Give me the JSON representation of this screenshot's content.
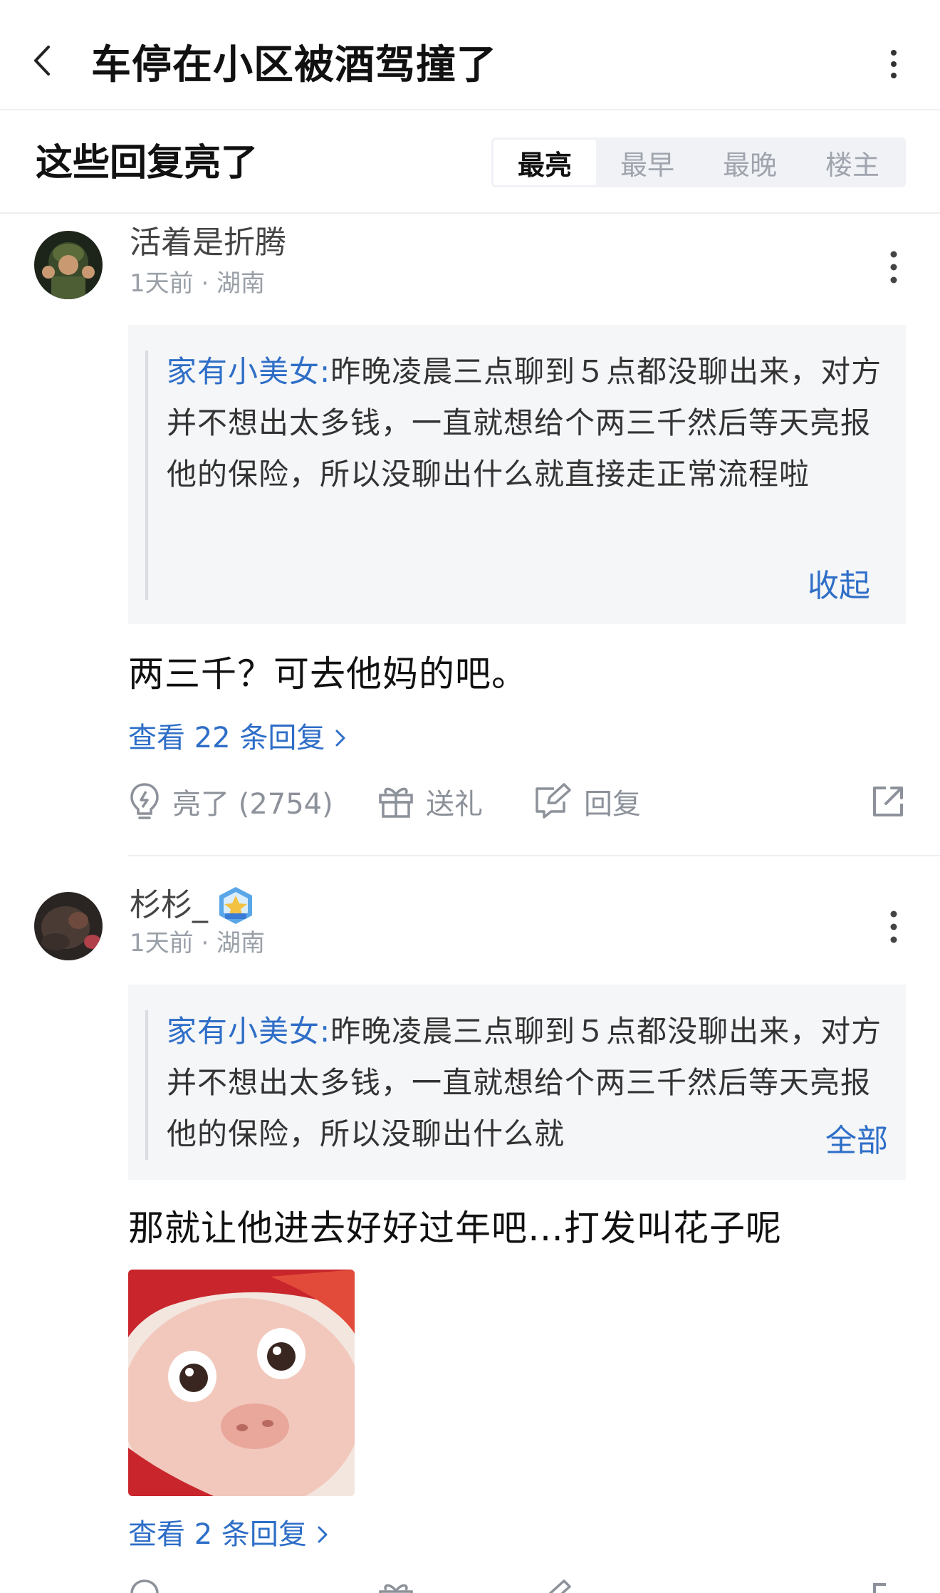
{
  "header": {
    "title": "车停在小区被酒驾撞了"
  },
  "section": {
    "title": "这些回复亮了",
    "tabs": [
      {
        "label": "最亮",
        "active": true
      },
      {
        "label": "最早",
        "active": false
      },
      {
        "label": "最晚",
        "active": false
      },
      {
        "label": "楼主",
        "active": false
      }
    ]
  },
  "comments": [
    {
      "username": "活着是折腾",
      "meta": "1天前 · 湖南",
      "quote_author": "家有小美女:",
      "quote_text": "昨晚凌晨三点聊到５点都没聊出来，对方并不想出太多钱，一直就想给个两三千然后等天亮报他的保险，所以没聊出什么就直接走正常流程啦",
      "quote_action": "收起",
      "body": "两三千？可去他妈的吧。",
      "view_replies": "查看 22 条回复",
      "actions": {
        "like": "亮了 (2754)",
        "gift": "送礼",
        "reply": "回复"
      }
    },
    {
      "username": "杉杉_",
      "meta": "1天前 · 湖南",
      "quote_author": "家有小美女:",
      "quote_text": "昨晚凌晨三点聊到５点都没聊出来，对方并不想出太多钱，一直就想给个两三千然后等天亮报他的保险，所以没聊出什么就",
      "quote_action": "全部",
      "body": "那就让他进去好好过年吧…打发叫花子呢",
      "view_replies": "查看 2 条回复"
    }
  ],
  "colors": {
    "link": "#2e6ec7",
    "muted": "#9aa0a8",
    "quote_bg": "#f5f6f8"
  }
}
